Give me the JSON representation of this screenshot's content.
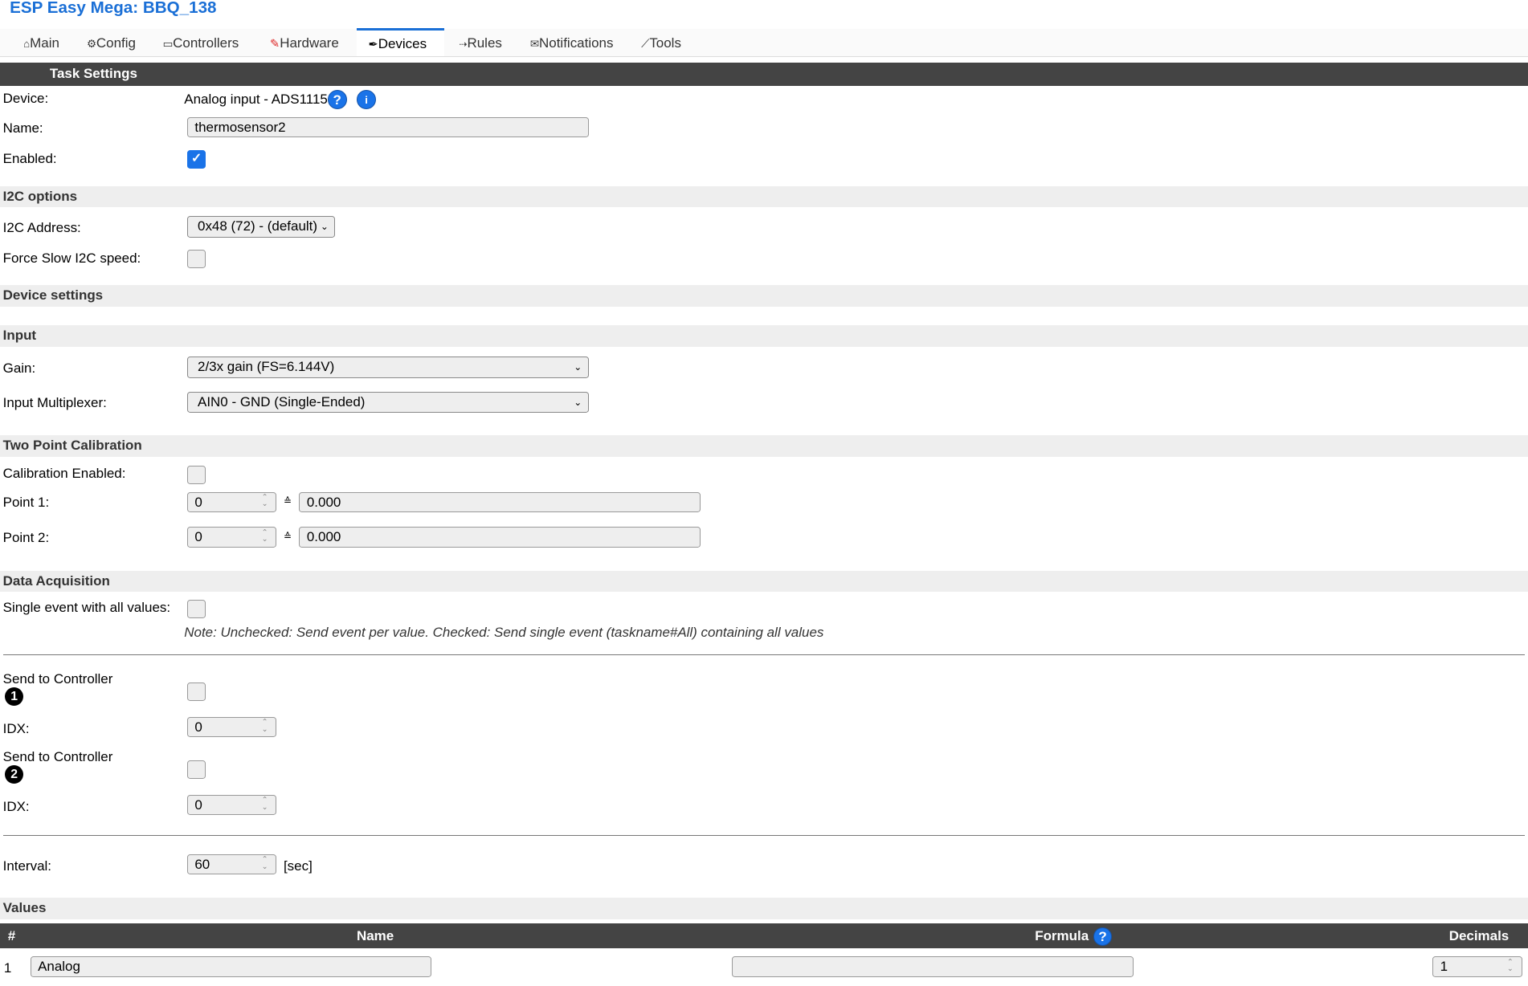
{
  "title": "ESP Easy Mega: BBQ_138",
  "tabs": [
    {
      "label": "Main",
      "icon": "home-icon",
      "glyph": "⌂"
    },
    {
      "label": "Config",
      "icon": "gear-icon",
      "glyph": "⚙"
    },
    {
      "label": "Controllers",
      "icon": "speech-bubble-icon",
      "glyph": "💬"
    },
    {
      "label": "Hardware",
      "icon": "pushpin-icon",
      "glyph": "📌"
    },
    {
      "label": "Devices",
      "icon": "plug-icon",
      "glyph": "🔌"
    },
    {
      "label": "Rules",
      "icon": "arrow-icon",
      "glyph": "⇢"
    },
    {
      "label": "Notifications",
      "icon": "envelope-icon",
      "glyph": "✉"
    },
    {
      "label": "Tools",
      "icon": "wrench-icon",
      "glyph": "🔧"
    }
  ],
  "active_tab": "Devices",
  "header": "Task Settings",
  "device": {
    "label": "Device:",
    "value": "Analog input - ADS1115",
    "help": "?",
    "info": "i"
  },
  "name": {
    "label": "Name:",
    "value": "thermosensor2"
  },
  "enabled": {
    "label": "Enabled:",
    "checked": true,
    "mark": "✓"
  },
  "i2c": {
    "section": "I2C options",
    "address_label": "I2C Address:",
    "address_value": "0x48 (72) - (default)",
    "slow_label": "Force Slow I2C speed:",
    "slow_checked": false
  },
  "device_settings": "Device settings",
  "input": {
    "section": "Input",
    "gain_label": "Gain:",
    "gain_value": "2/3x gain (FS=6.144V)",
    "mux_label": "Input Multiplexer:",
    "mux_value": "AIN0 - GND (Single-Ended)"
  },
  "calibration": {
    "section": "Two Point Calibration",
    "enabled_label": "Calibration Enabled:",
    "point1_label": "Point 1:",
    "point1_adc": "0",
    "point1_value": "0.000",
    "point2_label": "Point 2:",
    "point2_adc": "0",
    "point2_value": "0.000",
    "approx": "≙"
  },
  "acquisition": {
    "section": "Data Acquisition",
    "single_label": "Single event with all values:",
    "note": "Note: Unchecked: Send event per value. Checked: Send single event (taskname#All) containing all values",
    "controllers": [
      {
        "label": "Send to Controller",
        "num": "1",
        "idx_label": "IDX:",
        "idx": "0"
      },
      {
        "label": "Send to Controller",
        "num": "2",
        "idx_label": "IDX:",
        "idx": "0"
      }
    ],
    "interval_label": "Interval:",
    "interval": "60",
    "interval_unit": "[sec]"
  },
  "values": {
    "section": "Values",
    "columns": [
      "#",
      "Name",
      "Formula",
      "Decimals"
    ],
    "formula_help": "?",
    "rows": [
      {
        "num": "1",
        "name": "Analog",
        "formula": "",
        "decimals": "1"
      }
    ]
  },
  "colors": {
    "accent": "#1a73e8",
    "title": "#1a6fd6",
    "header_bar": "#444444",
    "section_band": "#eeeeee"
  }
}
